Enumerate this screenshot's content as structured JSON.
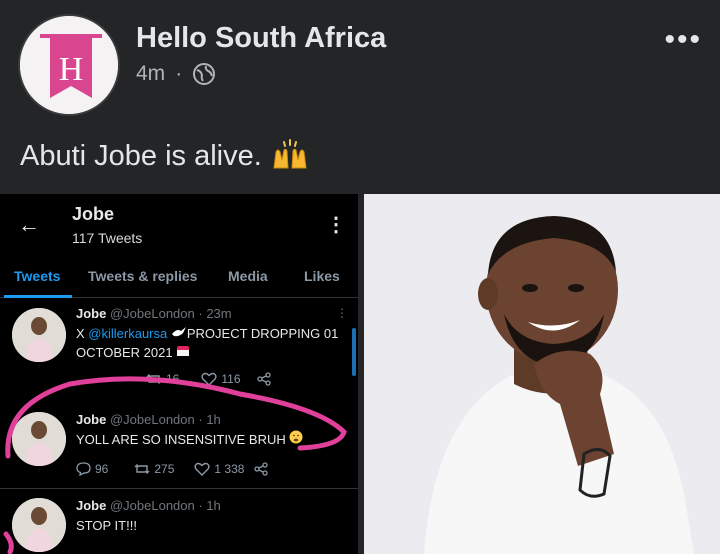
{
  "post": {
    "page_name": "Hello South Africa",
    "time": "4m",
    "separator": "·",
    "text": "Abuti Jobe is alive.",
    "more_label": "•••",
    "avatar_letter": "H"
  },
  "twitter": {
    "back_icon": "arrow-left-icon",
    "profile_name": "Jobe",
    "tweet_count": "117 Tweets",
    "tabs": [
      "Tweets",
      "Tweets & replies",
      "Media",
      "Likes"
    ],
    "tweets": [
      {
        "name": "Jobe",
        "handle": "@JobeLondon",
        "time": "· 23m",
        "prefix": "X ",
        "mention": "@killerkaursa",
        "body": "PROJECT DROPPING 01 OCTOBER 2021",
        "retweets": "16",
        "likes": "116"
      },
      {
        "name": "Jobe",
        "handle": "@JobeLondon",
        "time": "· 1h",
        "body": "YOLL ARE SO INSENSITIVE BRUH",
        "replies": "96",
        "retweets": "275",
        "likes": "1 338"
      },
      {
        "name": "Jobe",
        "handle": "@JobeLondon",
        "time": "· 1h",
        "body": "STOP IT!!!"
      }
    ]
  },
  "colors": {
    "background": "#242526",
    "accent_blue": "#1d9bf0",
    "highlight_pink": "#e0409a",
    "logo_pink": "#d9468f"
  }
}
